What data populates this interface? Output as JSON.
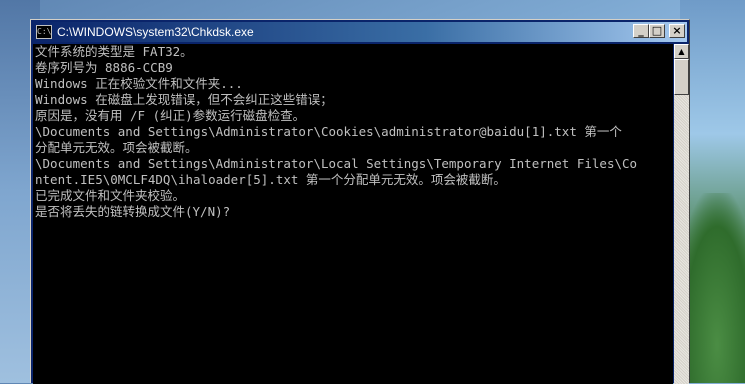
{
  "window": {
    "title": "C:\\WINDOWS\\system32\\Chkdsk.exe",
    "icon_label": "C:\\",
    "buttons": {
      "minimize": "_",
      "maximize": "□",
      "close": "×"
    }
  },
  "console": {
    "lines": [
      "文件系统的类型是 FAT32。",
      "卷序列号为 8886-CCB9",
      "Windows 正在校验文件和文件夹...",
      "Windows 在磁盘上发现错误，但不会纠正这些错误；",
      "原因是，没有用 /F (纠正)参数运行磁盘检查。",
      "\\Documents and Settings\\Administrator\\Cookies\\administrator@baidu[1].txt 第一个",
      "分配单元无效。项会被截断。",
      "\\Documents and Settings\\Administrator\\Local Settings\\Temporary Internet Files\\Co",
      "ntent.IE5\\0MCLF4DQ\\ihaloader[5].txt 第一个分配单元无效。项会被截断。",
      "已完成文件和文件夹校验。",
      "是否将丢失的链转换成文件(Y/N)?"
    ]
  },
  "scrollbar": {
    "up_arrow": "▲"
  },
  "colors": {
    "console_bg": "#000000",
    "console_text": "#c0c0c0",
    "titlebar": "#0a246a"
  }
}
